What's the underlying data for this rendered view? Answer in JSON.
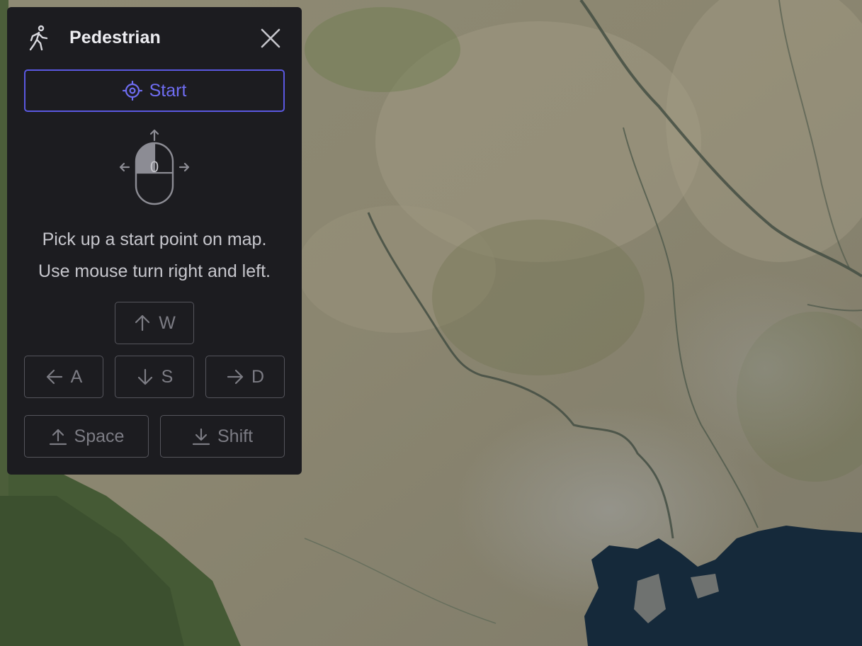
{
  "panel": {
    "title": "Pedestrian",
    "title_icon": "walking-person-icon",
    "close_icon": "close-icon",
    "start_button": {
      "label": "Start",
      "icon": "crosshair-target-icon"
    },
    "mouse_hint": {
      "icon": "mouse-drag-icon",
      "digit": "0"
    },
    "instructions": [
      "Pick up a start point on map.",
      "Use mouse turn right and left."
    ],
    "keys": {
      "forward": {
        "label": "W",
        "icon": "arrow-up-icon"
      },
      "left": {
        "label": "A",
        "icon": "arrow-left-icon"
      },
      "back": {
        "label": "S",
        "icon": "arrow-down-icon"
      },
      "right": {
        "label": "D",
        "icon": "arrow-right-icon"
      },
      "up": {
        "label": "Space",
        "icon": "arrow-up-bar-icon"
      },
      "down": {
        "label": "Shift",
        "icon": "arrow-down-bar-icon"
      }
    }
  },
  "colors": {
    "panel_bg": "#1c1c20",
    "accent": "#5a58e0",
    "key_text": "#7c7c84",
    "water": "#15293a",
    "land": "#8a8470"
  }
}
